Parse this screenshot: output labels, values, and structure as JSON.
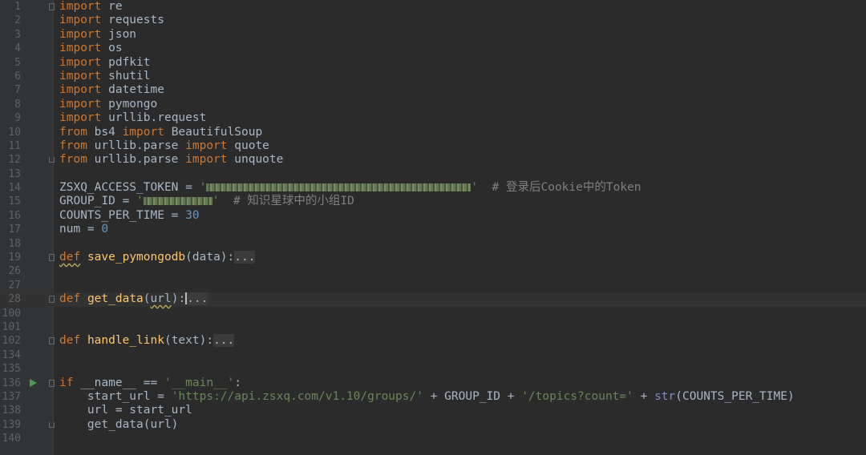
{
  "editor": {
    "imports": [
      {
        "ln": "1",
        "kw": "import",
        "mod": " re"
      },
      {
        "ln": "2",
        "kw": "import",
        "mod": " requests"
      },
      {
        "ln": "3",
        "kw": "import",
        "mod": " json"
      },
      {
        "ln": "4",
        "kw": "import",
        "mod": " os"
      },
      {
        "ln": "5",
        "kw": "import",
        "mod": " pdfkit"
      },
      {
        "ln": "6",
        "kw": "import",
        "mod": " shutil"
      },
      {
        "ln": "7",
        "kw": "import",
        "mod": " datetime"
      },
      {
        "ln": "8",
        "kw": "import",
        "mod": " pymongo"
      },
      {
        "ln": "9",
        "kw": "import",
        "mod": " urllib.request"
      }
    ],
    "from_imports": [
      {
        "ln": "10",
        "from": "from",
        "mod": " bs4 ",
        "imp": "import",
        "name": " BeautifulSoup"
      },
      {
        "ln": "11",
        "from": "from",
        "mod": " urllib.parse ",
        "imp": "import",
        "name": " quote"
      },
      {
        "ln": "12",
        "from": "from",
        "mod": " urllib.parse ",
        "imp": "import",
        "name": " unquote"
      }
    ],
    "ln13": "13",
    "token_line": {
      "ln": "14",
      "name": "ZSXQ_ACCESS_TOKEN = ",
      "q1": "'",
      "q2": "'",
      "comment": "  # 登录后Cookie中的Token"
    },
    "group_line": {
      "ln": "15",
      "name": "GROUP_ID = ",
      "q1": "'",
      "q2": "'",
      "comment": "  # 知识星球中的小组ID"
    },
    "counts_line": {
      "ln": "16",
      "name": "COUNTS_PER_TIME = ",
      "value": "30"
    },
    "num_line": {
      "ln": "17",
      "name": "num = ",
      "value": "0"
    },
    "ln18": "18",
    "save_def": {
      "ln": "19",
      "kw": "def",
      "fn": "save_pymongodb",
      "args": "(data):",
      "folded": "..."
    },
    "ln26": "26",
    "ln27": "27",
    "get_def": {
      "ln": "28",
      "kw": "def",
      "fn": "get_data",
      "open": "(",
      "arg": "url",
      "close": "):",
      "folded": "..."
    },
    "ln100": "100",
    "ln101": "101",
    "handle_def": {
      "ln": "102",
      "kw": "def",
      "fn": "handle_link",
      "args": "(text):",
      "folded": "..."
    },
    "ln134": "134",
    "ln135": "135",
    "main_if": {
      "ln": "136",
      "kw": "if",
      "mid": " __name__ == ",
      "str": "'__main__'",
      "end": ":"
    },
    "start_url": {
      "ln": "137",
      "a": "    start_url = ",
      "s1": "'https://api.zsxq.com/v1.10/groups/'",
      "b": " + GROUP_ID + ",
      "s2": "'/topics?count='",
      "c": " + ",
      "builtin": "str",
      "d": "(COUNTS_PER_TIME)"
    },
    "url_line": {
      "ln": "138",
      "text": "    url = start_url"
    },
    "get_call": {
      "ln": "139",
      "text": "    get_data(url)"
    },
    "ln140": "140"
  }
}
